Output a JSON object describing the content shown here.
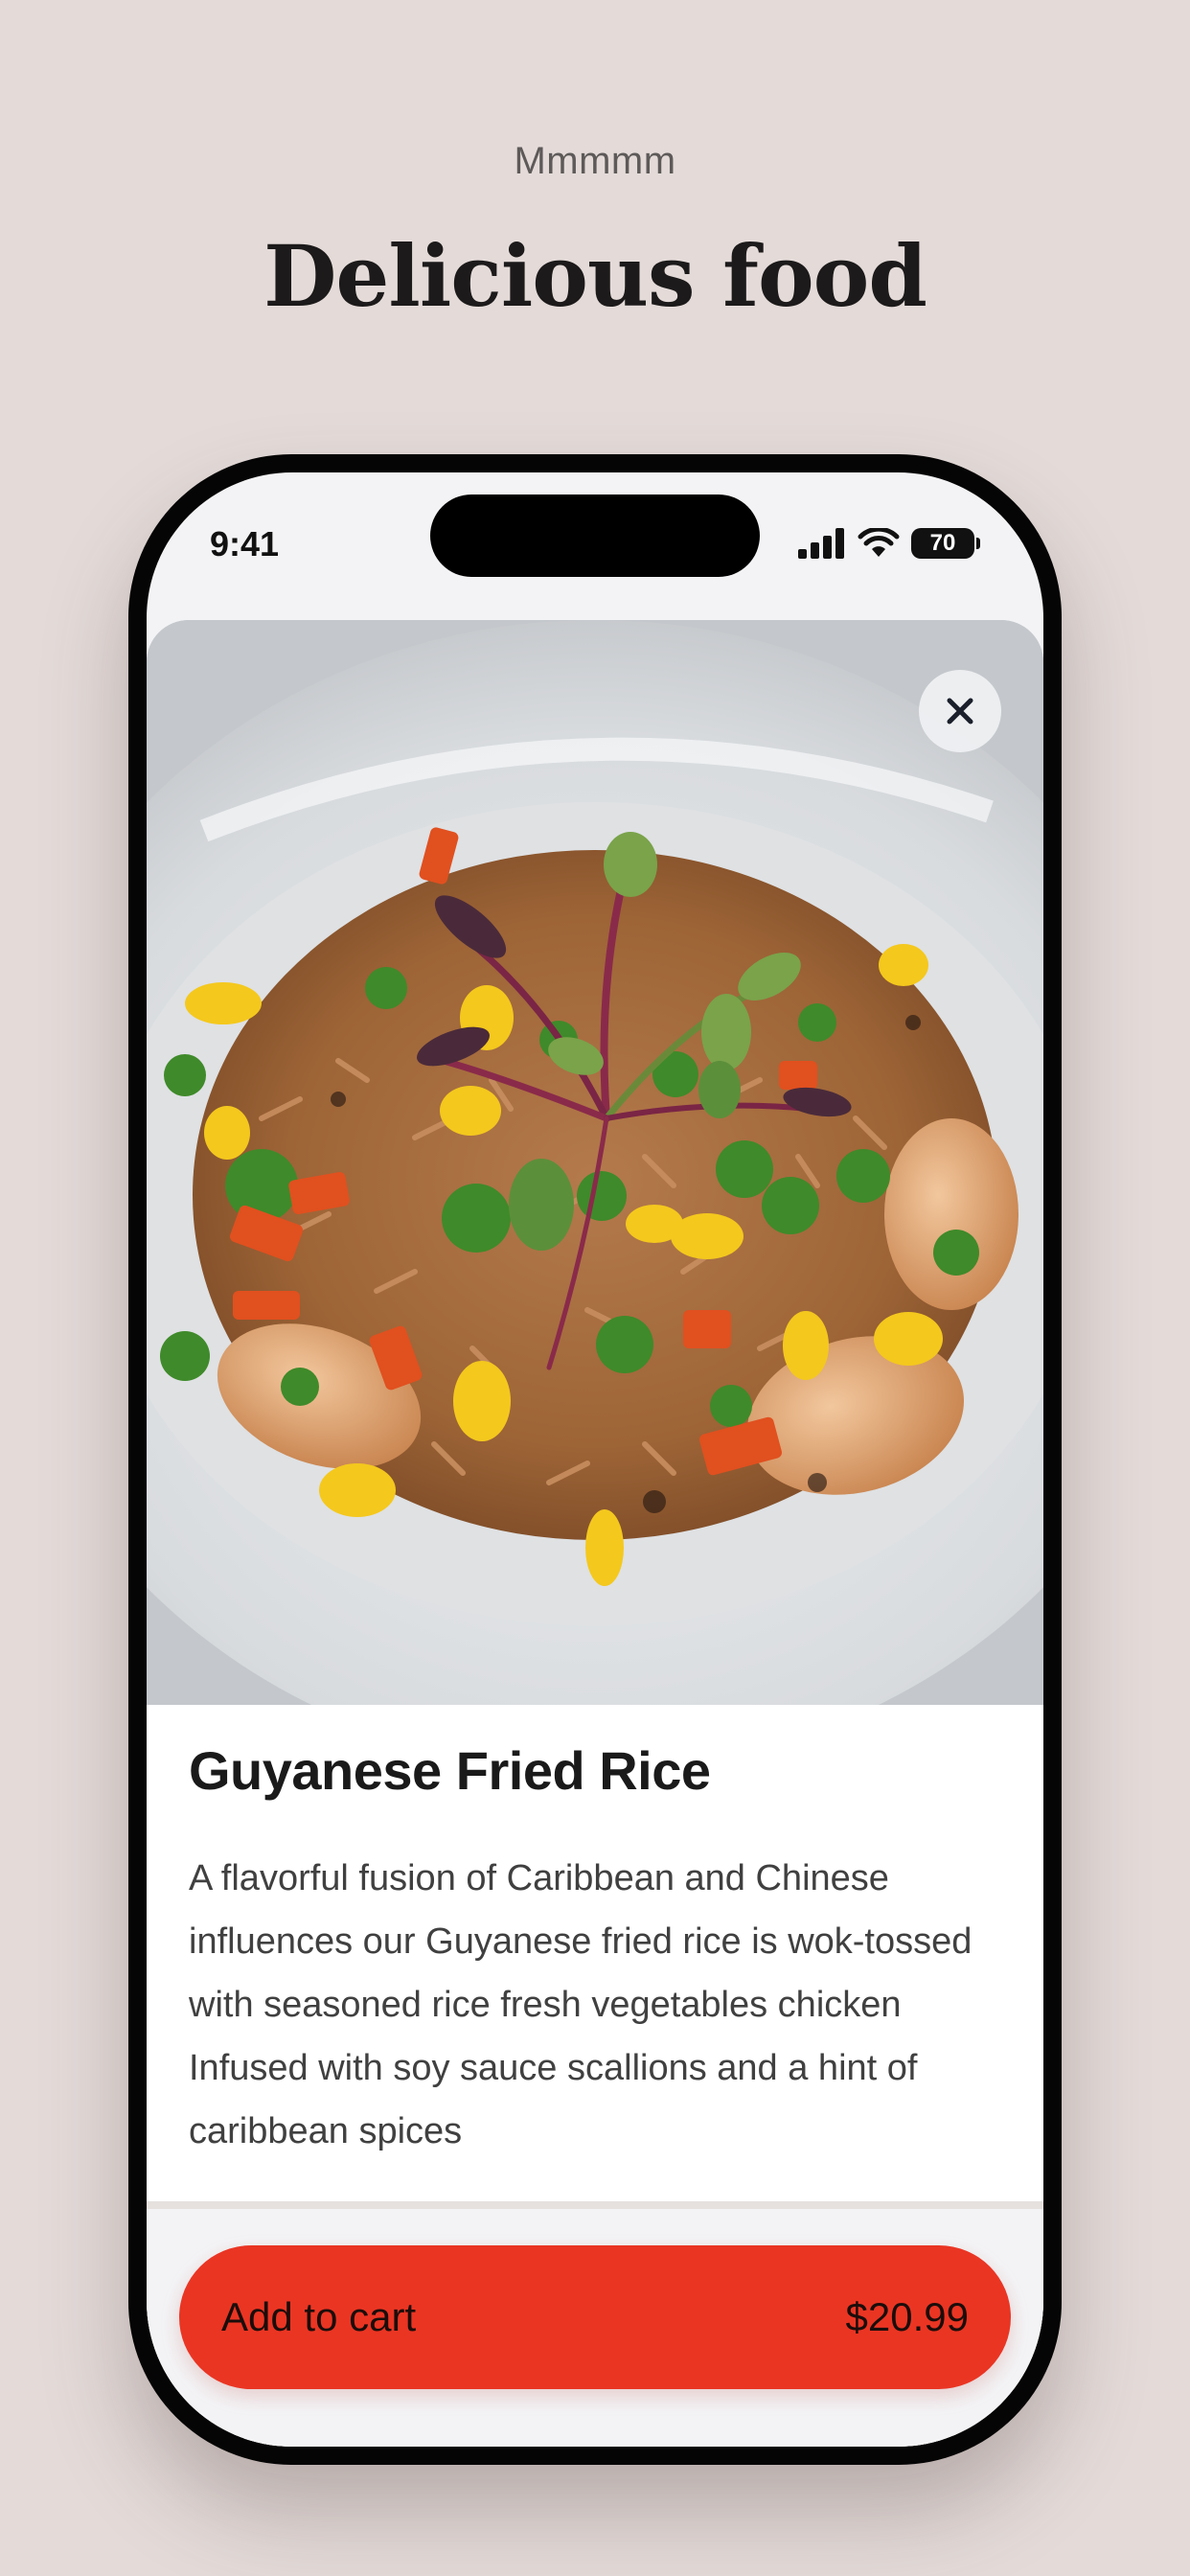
{
  "header": {
    "eyebrow": "Mmmmm",
    "title": "Delicious food"
  },
  "status_bar": {
    "time": "9:41",
    "battery": "70",
    "icons": [
      "signal-bars-icon",
      "wifi-icon",
      "battery-icon"
    ]
  },
  "product": {
    "image": "fried-rice-photo",
    "title": "Guyanese Fried Rice",
    "description": "A flavorful fusion of Caribbean and Chinese influences our Guyanese fried rice is wok-tossed with seasoned rice fresh vegetables chicken Infused with soy sauce scallions and a hint of caribbean spices",
    "close_icon": "close-icon"
  },
  "cart_button": {
    "label": "Add to cart",
    "price": "$20.99"
  },
  "colors": {
    "page_background": "#e4dbd9",
    "accent": "#ea3523",
    "phone_frame": "#050505",
    "screen_background": "#f3f3f5"
  }
}
